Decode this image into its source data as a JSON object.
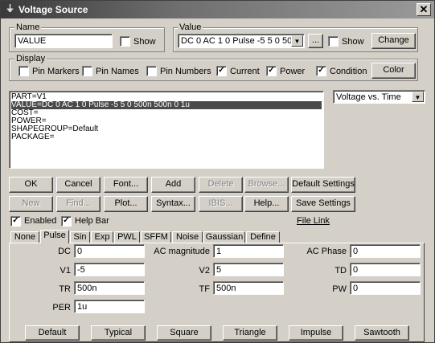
{
  "window": {
    "title": "Voltage Source",
    "close_label": "✕"
  },
  "name_group": {
    "label": "Name",
    "value": "VALUE",
    "show_label": "Show",
    "show_checked": false
  },
  "value_group": {
    "label": "Value",
    "value": "DC 0 AC 1 0 Pulse -5 5 0 50",
    "ellipsis_label": "...",
    "show_label": "Show",
    "show_checked": false,
    "change_label": "Change"
  },
  "display_group": {
    "label": "Display",
    "options": [
      {
        "label": "Pin Markers",
        "checked": false
      },
      {
        "label": "Pin Names",
        "checked": false
      },
      {
        "label": "Pin Numbers",
        "checked": false
      },
      {
        "label": "Current",
        "checked": true
      },
      {
        "label": "Power",
        "checked": true
      },
      {
        "label": "Condition",
        "checked": true
      }
    ],
    "color_label": "Color"
  },
  "attributes": [
    "PART=V1",
    "VALUE=DC 0 AC 1 0 Pulse -5 5 0 500n 500n 0 1u",
    "COST=",
    "POWER=",
    "SHAPEGROUP=Default",
    "PACKAGE="
  ],
  "selected_attribute": 1,
  "plot_select": {
    "value": "Voltage vs. Time"
  },
  "buttons_row1": {
    "ok": "OK",
    "cancel": "Cancel",
    "font": "Font...",
    "add": "Add",
    "delete": "Delete",
    "browse": "Browse...",
    "default_settings": "Default Settings"
  },
  "buttons_row2": {
    "new": "New",
    "find": "Find...",
    "plot": "Plot...",
    "syntax": "Syntax...",
    "ibis": "IBIS...",
    "help": "Help...",
    "save_settings": "Save Settings"
  },
  "enabled": {
    "label": "Enabled",
    "checked": true
  },
  "help_bar": {
    "label": "Help Bar",
    "checked": true
  },
  "file_link": "File Link",
  "tabs": [
    "None",
    "Pulse",
    "Sin",
    "Exp",
    "PWL",
    "SFFM",
    "Noise",
    "Gaussian",
    "Define"
  ],
  "active_tab": "Pulse",
  "pulse_fields": {
    "dc": {
      "label": "DC",
      "value": "0"
    },
    "ac_magnitude": {
      "label": "AC magnitude",
      "value": "1"
    },
    "ac_phase": {
      "label": "AC Phase",
      "value": "0"
    },
    "v1": {
      "label": "V1",
      "value": "-5"
    },
    "v2": {
      "label": "V2",
      "value": "5"
    },
    "td": {
      "label": "TD",
      "value": "0"
    },
    "tr": {
      "label": "TR",
      "value": "500n"
    },
    "tf": {
      "label": "TF",
      "value": "500n"
    },
    "pw": {
      "label": "PW",
      "value": "0"
    },
    "per": {
      "label": "PER",
      "value": "1u"
    }
  },
  "preset_buttons": {
    "default": "Default",
    "typical": "Typical",
    "square": "Square",
    "triangle": "Triangle",
    "impulse": "Impulse",
    "sawtooth": "Sawtooth"
  },
  "check_mark": "✓"
}
